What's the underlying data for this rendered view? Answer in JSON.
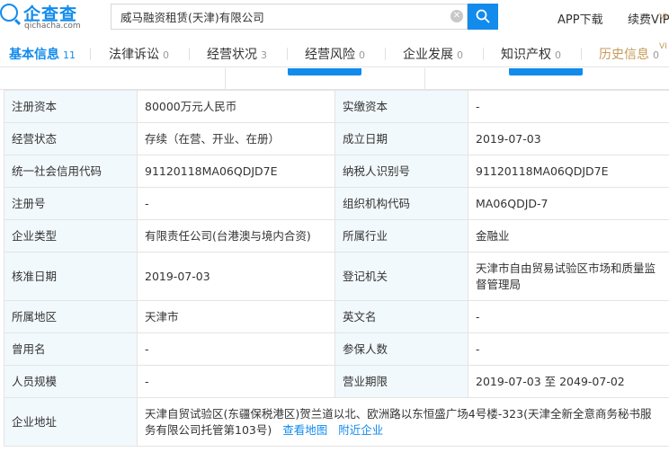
{
  "header": {
    "logo_cn": "企查查",
    "logo_en": "qichacha.com",
    "search_value": "威马融资租赁(天津)有限公司",
    "app_download": "APP下载",
    "renew_vip": "续费VIP",
    "vip_tag": "VI"
  },
  "tabs": [
    {
      "label": "基本信息",
      "count": "11"
    },
    {
      "label": "法律诉讼",
      "count": "0"
    },
    {
      "label": "经营状况",
      "count": "3"
    },
    {
      "label": "经营风险",
      "count": "0"
    },
    {
      "label": "企业发展",
      "count": "0"
    },
    {
      "label": "知识产权",
      "count": "0"
    },
    {
      "label": "历史信息",
      "count": "0"
    }
  ],
  "new_tag": "VI",
  "rows": [
    {
      "l1": "注册资本",
      "v1": "80000万元人民币",
      "l2": "实缴资本",
      "v2": "-"
    },
    {
      "l1": "经营状态",
      "v1": "存续（在营、开业、在册）",
      "l2": "成立日期",
      "v2": "2019-07-03"
    },
    {
      "l1": "统一社会信用代码",
      "v1": "91120118MA06QDJD7E",
      "l2": "纳税人识别号",
      "v2": "91120118MA06QDJD7E"
    },
    {
      "l1": "注册号",
      "v1": "-",
      "l2": "组织机构代码",
      "v2": "MA06QDJD-7"
    },
    {
      "l1": "企业类型",
      "v1": "有限责任公司(台港澳与境内合资)",
      "l2": "所属行业",
      "v2": "金融业"
    },
    {
      "l1": "核准日期",
      "v1": "2019-07-03",
      "l2": "登记机关",
      "v2": "天津市自由贸易试验区市场和质量监督管理局"
    },
    {
      "l1": "所属地区",
      "v1": "天津市",
      "l2": "英文名",
      "v2": "-"
    },
    {
      "l1": "曾用名",
      "v1": "-",
      "l2": "参保人数",
      "v2": "-"
    },
    {
      "l1": "人员规模",
      "v1": "-",
      "l2": "营业期限",
      "v2": "2019-07-03 至 2049-07-02"
    }
  ],
  "address": {
    "label": "企业地址",
    "value": "天津自贸试验区(东疆保税港区)贺兰道以北、欧洲路以东恒盛广场4号楼-323(天津全新全意商务秘书服务有限公司托管第103号)",
    "map_link": "查看地图",
    "nearby_link": "附近企业"
  }
}
